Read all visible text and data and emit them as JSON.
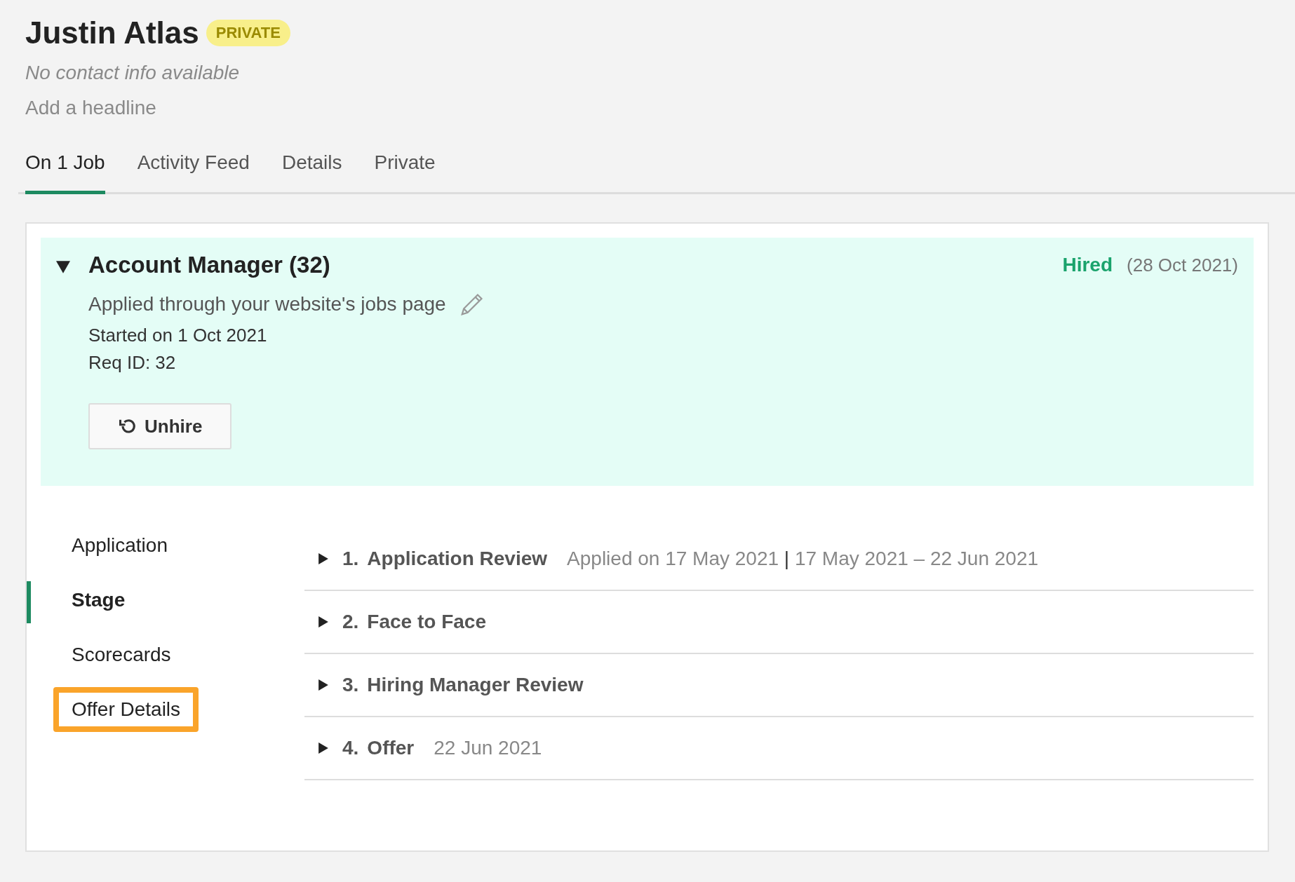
{
  "candidate": {
    "name": "Justin Atlas",
    "badge": "PRIVATE",
    "contact": "No contact info available",
    "headline_link": "Add a headline"
  },
  "tabs": [
    {
      "label": "On 1 Job",
      "selected": true
    },
    {
      "label": "Activity Feed",
      "selected": false
    },
    {
      "label": "Details",
      "selected": false
    },
    {
      "label": "Private",
      "selected": false
    }
  ],
  "job": {
    "expanded": true,
    "title": "Account Manager (32)",
    "status": "Hired",
    "status_date": "(28 Oct 2021)",
    "source": "Applied through your website's jobs page",
    "started": "Started on 1 Oct 2021",
    "req_id": "Req ID: 32",
    "button": "Unhire"
  },
  "nav": [
    {
      "label": "Application",
      "selected": false,
      "highlighted": false
    },
    {
      "label": "Stage",
      "selected": true,
      "highlighted": false
    },
    {
      "label": "Scorecards",
      "selected": false,
      "highlighted": false
    },
    {
      "label": "Offer Details",
      "selected": false,
      "highlighted": true
    }
  ],
  "stages": [
    {
      "number": "1.",
      "title": "Application Review",
      "meta": "Applied on 17 May 2021 **|** 17 May 2021 – 22 Jun 2021",
      "expanded": false
    },
    {
      "number": "2.",
      "title": "Face to Face",
      "expanded": false
    },
    {
      "number": "3.",
      "title": "Hiring Manager Review",
      "expanded": false
    },
    {
      "number": "4.",
      "title": "Offer",
      "meta": "22 Jun 2021",
      "expanded": false
    }
  ]
}
